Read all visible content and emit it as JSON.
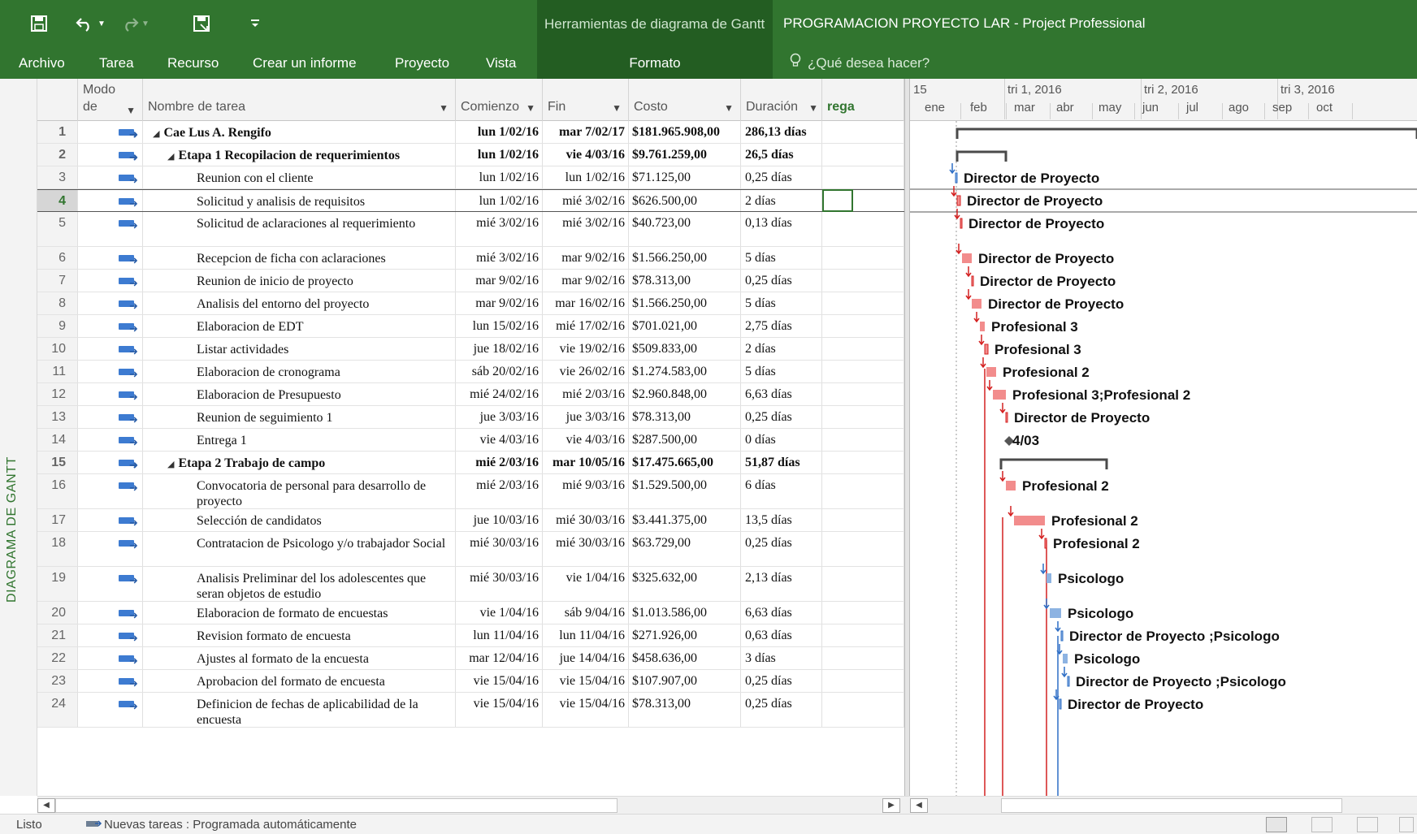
{
  "titlebar": {
    "context_title": "Herramientas de diagrama de Gantt",
    "app_title": "PROGRAMACION PROYECTO LAR - Project Professional",
    "quick_access": [
      {
        "name": "save-icon",
        "glyph": "🖫"
      },
      {
        "name": "undo-icon",
        "glyph": "↶ ▾"
      },
      {
        "name": "redo-icon",
        "glyph": "↷ ▾"
      },
      {
        "name": "save-as-icon",
        "glyph": "🖫"
      },
      {
        "name": "customize-qat-icon",
        "glyph": "⇩"
      }
    ]
  },
  "ribbon": {
    "tabs": [
      "Archivo",
      "Tarea",
      "Recurso",
      "Crear un informe",
      "Proyecto",
      "Vista",
      "Formato"
    ],
    "tell_me": "¿Qué desea hacer?"
  },
  "sidebar": {
    "view_label": "DIAGRAMA DE GANTT"
  },
  "grid": {
    "columns": {
      "mode_top": "Modo",
      "mode_bottom": "de",
      "name": "Nombre de tarea",
      "start": "Comienzo",
      "finish": "Fin",
      "cost": "Costo",
      "duration": "Duración",
      "extra": "rega"
    },
    "rows": [
      {
        "id": "1",
        "name": "Cae Lus A. Rengifo",
        "start": "lun 1/02/16",
        "finish": "mar 7/02/17",
        "cost": "$181.965.908,00",
        "duration": "286,13 días",
        "level": 0,
        "summary": true
      },
      {
        "id": "2",
        "name": "Etapa 1 Recopilacion de requerimientos",
        "start": "lun 1/02/16",
        "finish": "vie 4/03/16",
        "cost": "$9.761.259,00",
        "duration": "26,5 días",
        "level": 1,
        "summary": true
      },
      {
        "id": "3",
        "name": "Reunion con el cliente",
        "start": "lun 1/02/16",
        "finish": "lun 1/02/16",
        "cost": "$71.125,00",
        "duration": "0,25 días",
        "level": 2
      },
      {
        "id": "4",
        "name": "Solicitud y analisis de requisitos",
        "start": "lun 1/02/16",
        "finish": "mié 3/02/16",
        "cost": "$626.500,00",
        "duration": "2 días",
        "level": 2,
        "selected": true
      },
      {
        "id": "5",
        "name": "Solicitud de aclaraciones al requerimiento",
        "start": "mié 3/02/16",
        "finish": "mié 3/02/16",
        "cost": "$40.723,00",
        "duration": "0,13 días",
        "level": 2,
        "tall": true
      },
      {
        "id": "6",
        "name": "Recepcion de ficha con aclaraciones",
        "start": "mié 3/02/16",
        "finish": "mar 9/02/16",
        "cost": "$1.566.250,00",
        "duration": "5 días",
        "level": 2
      },
      {
        "id": "7",
        "name": "Reunion de inicio de proyecto",
        "start": "mar 9/02/16",
        "finish": "mar 9/02/16",
        "cost": "$78.313,00",
        "duration": "0,25 días",
        "level": 2
      },
      {
        "id": "8",
        "name": "Analisis del entorno del proyecto",
        "start": "mar 9/02/16",
        "finish": "mar 16/02/16",
        "cost": "$1.566.250,00",
        "duration": "5 días",
        "level": 2
      },
      {
        "id": "9",
        "name": "Elaboracion de EDT",
        "start": "lun 15/02/16",
        "finish": "mié 17/02/16",
        "cost": "$701.021,00",
        "duration": "2,75 días",
        "level": 2
      },
      {
        "id": "10",
        "name": "Listar actividades",
        "start": "jue 18/02/16",
        "finish": "vie 19/02/16",
        "cost": "$509.833,00",
        "duration": "2 días",
        "level": 2
      },
      {
        "id": "11",
        "name": "Elaboracion de cronograma",
        "start": "sáb 20/02/16",
        "finish": "vie 26/02/16",
        "cost": "$1.274.583,00",
        "duration": "5 días",
        "level": 2
      },
      {
        "id": "12",
        "name": "Elaboracion de Presupuesto",
        "start": "mié 24/02/16",
        "finish": "mié 2/03/16",
        "cost": "$2.960.848,00",
        "duration": "6,63 días",
        "level": 2
      },
      {
        "id": "13",
        "name": "Reunion de seguimiento 1",
        "start": "jue 3/03/16",
        "finish": "jue 3/03/16",
        "cost": "$78.313,00",
        "duration": "0,25 días",
        "level": 2
      },
      {
        "id": "14",
        "name": "Entrega 1",
        "start": "vie 4/03/16",
        "finish": "vie 4/03/16",
        "cost": "$287.500,00",
        "duration": "0 días",
        "level": 2
      },
      {
        "id": "15",
        "name": "Etapa 2 Trabajo de campo",
        "start": "mié 2/03/16",
        "finish": "mar 10/05/16",
        "cost": "$17.475.665,00",
        "duration": "51,87 días",
        "level": 1,
        "summary": true
      },
      {
        "id": "16",
        "name": "Convocatoria de personal para desarrollo de proyecto",
        "start": "mié 2/03/16",
        "finish": "mié 9/03/16",
        "cost": "$1.529.500,00",
        "duration": "6 días",
        "level": 2,
        "tall": true
      },
      {
        "id": "17",
        "name": "Selección de candidatos",
        "start": "jue 10/03/16",
        "finish": "mié 30/03/16",
        "cost": "$3.441.375,00",
        "duration": "13,5 días",
        "level": 2
      },
      {
        "id": "18",
        "name": "Contratacion de Psicologo y/o trabajador Social",
        "start": "mié 30/03/16",
        "finish": "mié 30/03/16",
        "cost": "$63.729,00",
        "duration": "0,25 días",
        "level": 2,
        "tall": true
      },
      {
        "id": "19",
        "name": "Analisis Preliminar del los adolescentes que seran objetos de estudio",
        "start": "mié 30/03/16",
        "finish": "vie 1/04/16",
        "cost": "$325.632,00",
        "duration": "2,13 días",
        "level": 2,
        "tall": true
      },
      {
        "id": "20",
        "name": "Elaboracion de formato de encuestas",
        "start": "vie 1/04/16",
        "finish": "sáb 9/04/16",
        "cost": "$1.013.586,00",
        "duration": "6,63 días",
        "level": 2
      },
      {
        "id": "21",
        "name": "Revision formato de encuesta",
        "start": "lun 11/04/16",
        "finish": "lun 11/04/16",
        "cost": "$271.926,00",
        "duration": "0,63 días",
        "level": 2
      },
      {
        "id": "22",
        "name": "Ajustes al formato de la encuesta",
        "start": "mar 12/04/16",
        "finish": "jue 14/04/16",
        "cost": "$458.636,00",
        "duration": "3 días",
        "level": 2
      },
      {
        "id": "23",
        "name": "Aprobacion del formato de encuesta",
        "start": "vie 15/04/16",
        "finish": "vie 15/04/16",
        "cost": "$107.907,00",
        "duration": "0,25 días",
        "level": 2
      },
      {
        "id": "24",
        "name": "Definicion de fechas de aplicabilidad de la encuesta",
        "start": "vie 15/04/16",
        "finish": "vie 15/04/16",
        "cost": "$78.313,00",
        "duration": "0,25 días",
        "level": 2,
        "tall": true
      }
    ]
  },
  "timeline": {
    "quarters": [
      "15",
      "tri 1, 2016",
      "tri 2, 2016",
      "tri 3, 2016"
    ],
    "months": [
      "ene",
      "feb",
      "mar",
      "abr",
      "may",
      "jun",
      "jul",
      "ago",
      "sep",
      "oct"
    ],
    "bar_labels": [
      "",
      "",
      "Director de Proyecto",
      "Director de Proyecto",
      "Director de Proyecto",
      "Director de Proyecto",
      "Director de Proyecto",
      "Director de Proyecto",
      "Profesional 3",
      "Profesional 3",
      "Profesional 2",
      "Profesional 3;Profesional 2",
      "Director de Proyecto",
      "4/03",
      "",
      "Profesional 2",
      "Profesional 2",
      "Profesional 2",
      "Psicologo",
      "Psicologo",
      "Director de Proyecto ;Psicologo",
      "Psicologo",
      "Director de Proyecto ;Psicologo",
      "Director de Proyecto"
    ],
    "colors": {
      "critical": "#f28c8c",
      "critical_link": "#d42020",
      "normal": "#8db3e2",
      "normal_link": "#2f6fc6",
      "summary": "#4a4a4a"
    }
  },
  "status": {
    "ready": "Listo",
    "new_tasks": "Nuevas tareas : Programada automáticamente"
  }
}
